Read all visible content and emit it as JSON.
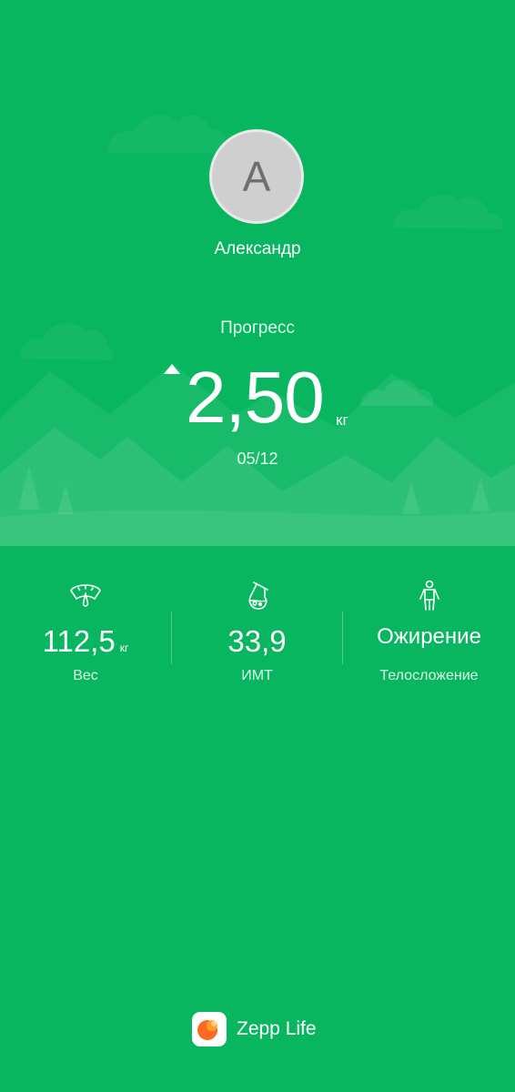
{
  "profile": {
    "initial": "А",
    "name": "Александр"
  },
  "progress": {
    "label": "Прогресс",
    "value": "2,50",
    "unit": "кг",
    "date": "05/12",
    "trend": "up-triangle-icon"
  },
  "metrics": [
    {
      "icon": "scale-icon",
      "value": "112,5",
      "unit": "кг",
      "label": "Вес"
    },
    {
      "icon": "flask-icon",
      "value": "33,9",
      "unit": "",
      "label": "ИМТ"
    },
    {
      "icon": "body-figure-icon",
      "value": "Ожирение",
      "unit": "",
      "label": "Телосложение"
    }
  ],
  "brand": {
    "name": "Zepp Life",
    "logo": "zepp-life-logo"
  },
  "colors": {
    "background": "#07b65e",
    "mountain": "#2bc472",
    "logo_orange": "#ff6a22"
  }
}
